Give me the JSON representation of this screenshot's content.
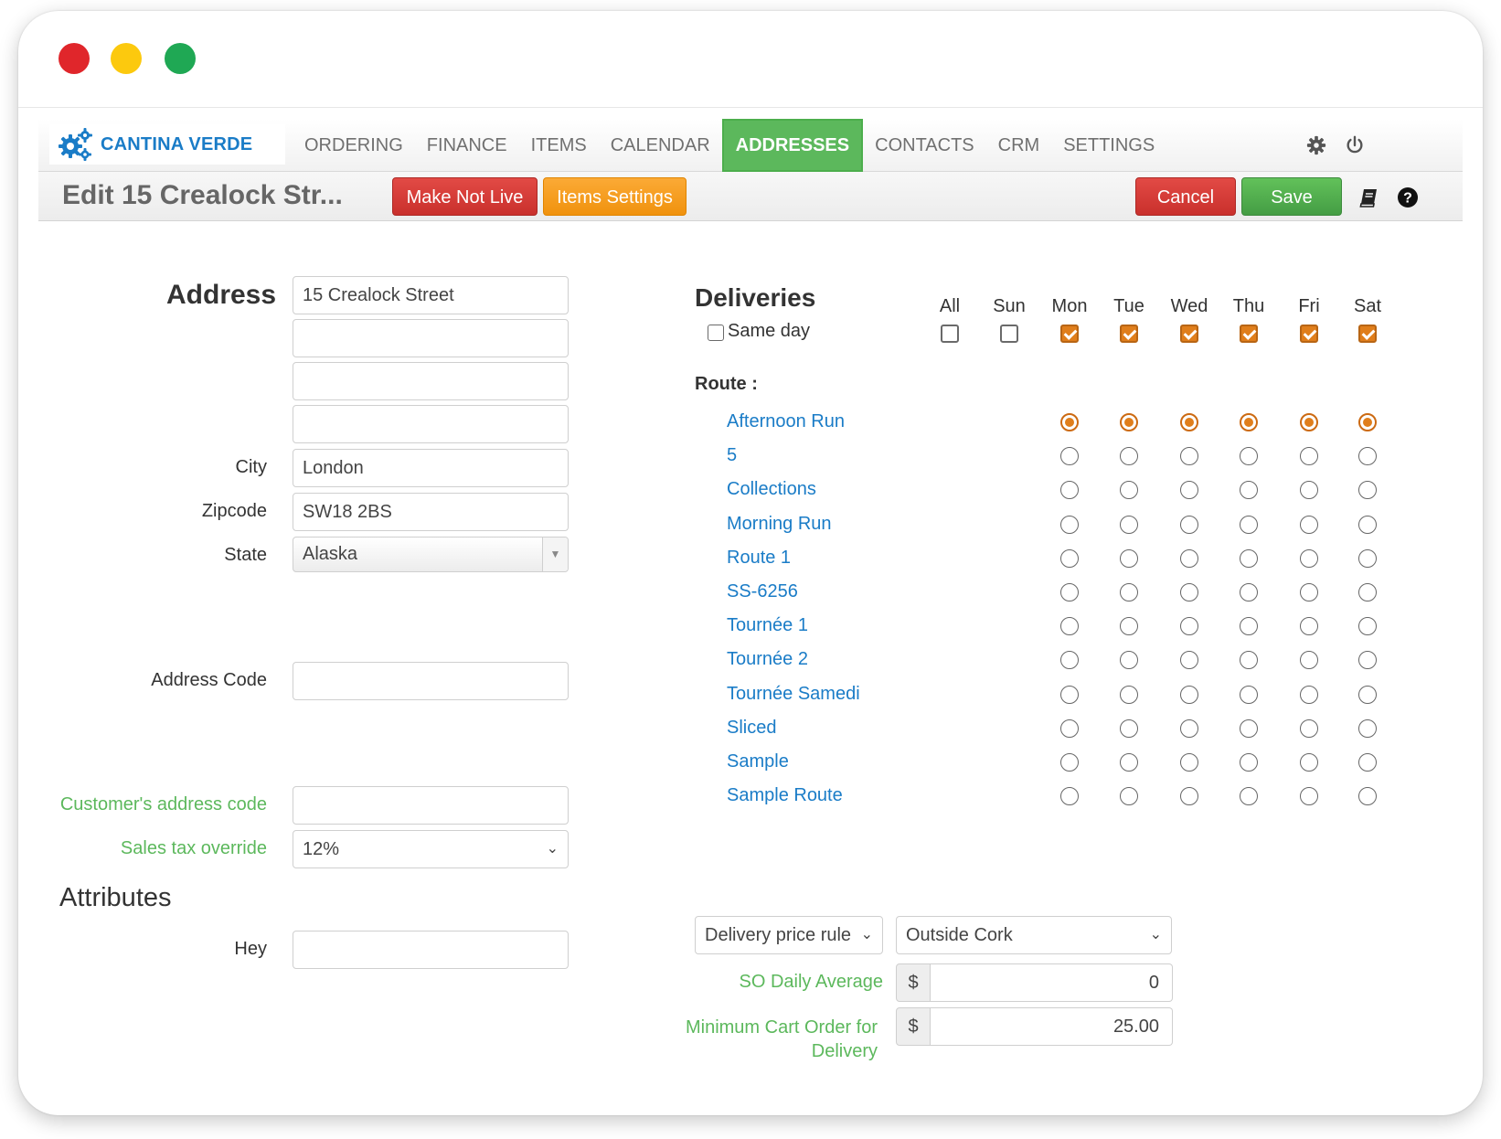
{
  "brand": {
    "name": "CANTINA VERDE"
  },
  "nav": {
    "items": [
      "ORDERING",
      "FINANCE",
      "ITEMS",
      "CALENDAR",
      "ADDRESSES",
      "CONTACTS",
      "CRM",
      "SETTINGS"
    ],
    "active": "ADDRESSES"
  },
  "toolbar": {
    "title": "Edit 15 Crealock Str...",
    "make_not_live": "Make Not Live",
    "items_settings": "Items Settings",
    "cancel": "Cancel",
    "save": "Save"
  },
  "address": {
    "heading": "Address",
    "line1": "15 Crealock Street",
    "line2": "",
    "line3": "",
    "line4": "",
    "city_label": "City",
    "city": "London",
    "zip_label": "Zipcode",
    "zip": "SW18 2BS",
    "state_label": "State",
    "state": "Alaska",
    "code_label": "Address Code",
    "code": "",
    "customer_code_label": "Customer's address code",
    "customer_code": "",
    "sales_tax_label": "Sales tax override",
    "sales_tax": "12%"
  },
  "attributes": {
    "heading": "Attributes",
    "hey_label": "Hey",
    "hey_value": ""
  },
  "deliveries": {
    "heading": "Deliveries",
    "same_day_label": "Same day",
    "same_day": false,
    "route_label": "Route :",
    "days": [
      {
        "label": "All",
        "checked": false
      },
      {
        "label": "Sun",
        "checked": false
      },
      {
        "label": "Mon",
        "checked": true
      },
      {
        "label": "Tue",
        "checked": true
      },
      {
        "label": "Wed",
        "checked": true
      },
      {
        "label": "Thu",
        "checked": true
      },
      {
        "label": "Fri",
        "checked": true
      },
      {
        "label": "Sat",
        "checked": true
      }
    ],
    "routes": [
      "Afternoon Run",
      "5",
      "Collections",
      "Morning Run",
      "Route 1",
      "SS-6256",
      "Tournée 1",
      "Tournée 2",
      "Tournée Samedi",
      "Sliced",
      "Sample",
      "Sample Route"
    ],
    "selected_route": "Afternoon Run"
  },
  "pricing": {
    "rule_select": "Delivery price rule",
    "rule_value": "Outside Cork",
    "so_daily_label": "SO Daily Average",
    "so_daily_value": "0",
    "min_cart_label": "Minimum Cart Order for Delivery",
    "min_cart_value": "25.00",
    "currency": "$"
  },
  "colors": {
    "brand_blue": "#1a7cc7",
    "active_green": "#5cb85c",
    "danger_red": "#d9534f",
    "warning_orange": "#f0ad4e",
    "check_orange": "#e07e1b"
  }
}
